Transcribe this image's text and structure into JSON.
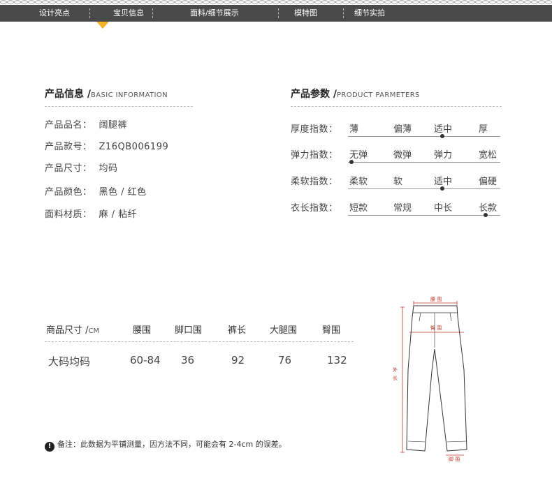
{
  "nav": {
    "items": [
      "设计亮点",
      "宝贝信息",
      "面料/细节展示",
      "模特图",
      "细节实拍"
    ],
    "active_index": 1,
    "accent_color": "#f2b327",
    "bar_color": "#4a4a4a"
  },
  "product_info": {
    "title": "产品信息 /",
    "subtitle": "BASIC INFORMATION",
    "rows": [
      {
        "label": "产品品名：",
        "value": "阔腿裤"
      },
      {
        "label": "产品款号：",
        "value": "Z16QB006199"
      },
      {
        "label": "产品尺寸：",
        "value": "均码"
      },
      {
        "label": "产品颜色：",
        "value": "黑色 / 红色"
      },
      {
        "label": "面料材质：",
        "value": "麻 / 粘纤"
      }
    ]
  },
  "product_params": {
    "title": "产品参数 /",
    "subtitle": "PRODUCT PARMETERS",
    "rows": [
      {
        "label": "厚度指数：",
        "options": [
          "薄",
          "偏薄",
          "适中",
          "厚"
        ],
        "selected": 2
      },
      {
        "label": "弹力指数：",
        "options": [
          "无弹",
          "微弹",
          "弹力",
          "宽松"
        ],
        "selected": 0
      },
      {
        "label": "柔软指数：",
        "options": [
          "柔软",
          "软",
          "适中",
          "偏硬"
        ],
        "selected": 2
      },
      {
        "label": "衣长指数：",
        "options": [
          "短款",
          "常规",
          "中长",
          "长款"
        ],
        "selected": 3
      }
    ]
  },
  "size_table": {
    "header_label": "商品尺寸 /",
    "header_unit": "CM",
    "columns": [
      "腰围",
      "脚口围",
      "裤长",
      "大腿围",
      "臀围"
    ],
    "rows": [
      {
        "name": "大码均码",
        "values": [
          "60-84",
          "36",
          "92",
          "76",
          "132"
        ]
      }
    ]
  },
  "note": {
    "icon": "exclamation-icon",
    "text": "备注：此数据为平铺测量，因方法不同，可能会有 2-4cm 的误差。"
  },
  "diagram": {
    "waist_label": "腰 围",
    "hip_label": "臀 围",
    "length_label_1": "外",
    "length_label_2": "长",
    "hem_label": "脚 围",
    "measure_color": "#c0392b"
  }
}
